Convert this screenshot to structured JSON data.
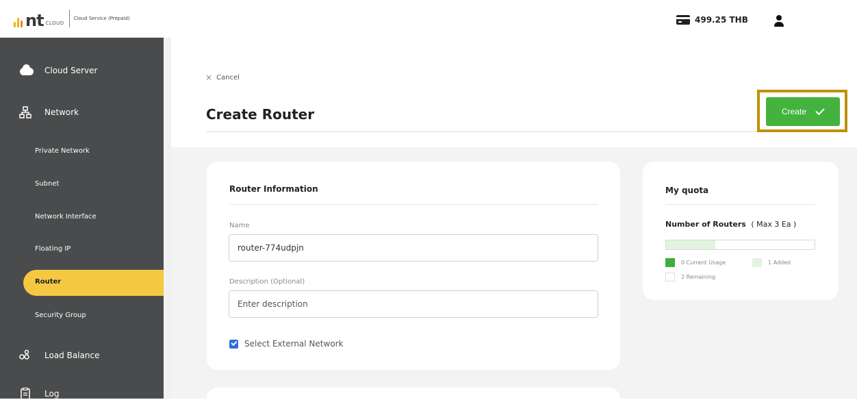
{
  "header": {
    "brand": "nt",
    "brand_sub": "CLOUD",
    "service_label": "Cloud Service (Prepaid)",
    "balance": "499.25 THB"
  },
  "sidebar": {
    "items": [
      {
        "label": "Cloud Server",
        "icon": "cloud-icon"
      },
      {
        "label": "Network",
        "icon": "network-icon"
      },
      {
        "label": "Private Network"
      },
      {
        "label": "Subnet"
      },
      {
        "label": "Network Interface"
      },
      {
        "label": "Floating IP"
      },
      {
        "label": "Router"
      },
      {
        "label": "Security Group"
      },
      {
        "label": "Load Balance",
        "icon": "load-balance-icon"
      },
      {
        "label": "Log",
        "icon": "clipboard-icon"
      }
    ],
    "active_item": "Router"
  },
  "page": {
    "cancel_label": "Cancel",
    "title": "Create Router",
    "create_label": "Create"
  },
  "router_info": {
    "title": "Router Information",
    "name_label": "Name",
    "name_value": "router-774udpjn",
    "description_label": "Description (Optional)",
    "description_placeholder": "Enter description",
    "external_network_label": "Select External Network",
    "external_network_checked": true
  },
  "quota": {
    "title": "My quota",
    "metric": "Number of Routers",
    "max_label": "( Max 3 Ea )",
    "current_usage": "0 Current Usage",
    "added": "1 Added",
    "remaining": "2 Remaining",
    "fill_fraction": 0.333
  },
  "colors": {
    "sidebar_bg": "#4a4b4c",
    "active": "#f5c842",
    "create_button": "#43b33e",
    "highlight": "#c0900a",
    "current_usage": "#3fae3a",
    "added": "#e2f4df",
    "checkbox": "#2d6fd8"
  }
}
